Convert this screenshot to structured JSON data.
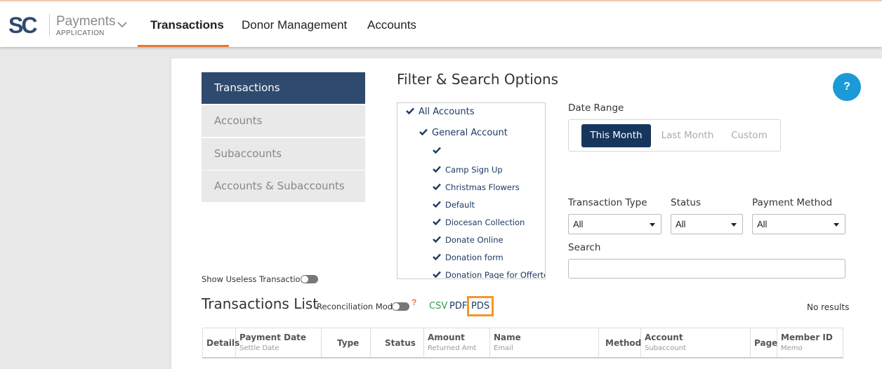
{
  "header": {
    "logo_text": "SC",
    "app_name": "Payments",
    "app_sub": "APPLICATION",
    "nav": [
      "Transactions",
      "Donor Management",
      "Accounts"
    ],
    "active_nav": "Transactions"
  },
  "sidebar": {
    "items": [
      "Transactions",
      "Accounts",
      "Subaccounts",
      "Accounts & Subaccounts"
    ],
    "active": "Transactions"
  },
  "filters": {
    "title": "Filter & Search Options",
    "accounts": [
      {
        "label": "All Accounts",
        "checked": true
      },
      {
        "label": "General Account",
        "checked": true
      },
      {
        "label": "",
        "checked": true
      },
      {
        "label": "Camp Sign Up",
        "checked": true
      },
      {
        "label": "Christmas Flowers",
        "checked": true
      },
      {
        "label": "Default",
        "checked": true
      },
      {
        "label": "Diocesan Collection",
        "checked": true
      },
      {
        "label": "Donate Online",
        "checked": true
      },
      {
        "label": "Donation form",
        "checked": true
      },
      {
        "label": "Donation Page for Offertory",
        "checked": true
      }
    ],
    "date_range": {
      "label": "Date Range",
      "options": [
        "This Month",
        "Last Month",
        "Custom"
      ],
      "selected": "This Month"
    },
    "transaction_type": {
      "label": "Transaction Type",
      "value": "All"
    },
    "status": {
      "label": "Status",
      "value": "All"
    },
    "payment_method": {
      "label": "Payment Method",
      "value": "All"
    },
    "search": {
      "label": "Search",
      "value": "",
      "placeholder": ""
    },
    "help_label": "?"
  },
  "list": {
    "show_useless_label": "Show Useless Transactions",
    "title": "Transactions List",
    "reconciliation_label": "Reconciliation Mode",
    "reconciliation_help": "?",
    "exports": {
      "csv": "CSV",
      "pdf": "PDF",
      "pds": "PDS"
    },
    "no_results": "No results",
    "columns": [
      {
        "label": "Details",
        "sub": ""
      },
      {
        "label": "Payment Date",
        "sub": "Settle Date"
      },
      {
        "label": "Type",
        "sub": ""
      },
      {
        "label": "Status",
        "sub": ""
      },
      {
        "label": "Amount",
        "sub": "Returned Amt"
      },
      {
        "label": "Name",
        "sub": "Email"
      },
      {
        "label": "Method",
        "sub": ""
      },
      {
        "label": "Account",
        "sub": "Subaccount"
      },
      {
        "label": "Page",
        "sub": ""
      },
      {
        "label": "Member ID",
        "sub": "Memo"
      }
    ]
  },
  "colors": {
    "brand_navy": "#2e4a6e",
    "active_navy": "#17365d",
    "accent_orange": "#e8783a",
    "highlight_orange": "#f5962a",
    "help_blue": "#1a9bd7",
    "csv_green": "#3a9a4a"
  }
}
